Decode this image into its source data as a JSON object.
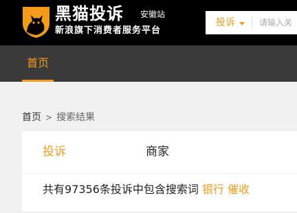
{
  "header": {
    "brand_name": "黑猫投诉",
    "brand_slogan": "新浪旗下消费者服务平台",
    "site_name": "安徽站",
    "logo_icon": "black-cat-shield-logo",
    "background_color": "#000000",
    "accent_color": "#f59b1c"
  },
  "search": {
    "type_label": "投诉",
    "placeholder": "请输入关",
    "value": ""
  },
  "nav": {
    "items": [
      {
        "label": "首页",
        "active": true
      }
    ]
  },
  "breadcrumb": {
    "home": "首页",
    "separator": ">",
    "current": "搜索结果"
  },
  "results": {
    "tabs": [
      {
        "label": "投诉",
        "active": true
      },
      {
        "label": "商家",
        "active": false
      }
    ],
    "summary_prefix": "共有",
    "count": "97356",
    "summary_middle": "条投诉中包含搜索词",
    "keywords": [
      "银行",
      "催收"
    ]
  }
}
